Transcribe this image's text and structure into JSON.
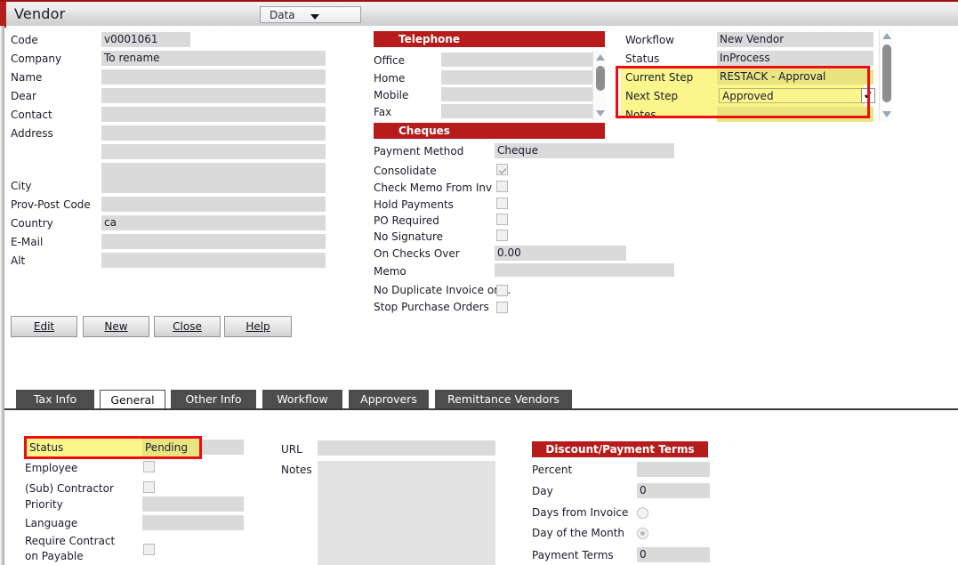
{
  "window": {
    "title": "Vendor",
    "data_menu": "Data"
  },
  "vendor_form": {
    "fields": [
      {
        "label": "Code",
        "value": "v0001061"
      },
      {
        "label": "Company",
        "value": "To rename"
      },
      {
        "label": "Name",
        "value": ""
      },
      {
        "label": "Dear",
        "value": ""
      },
      {
        "label": "Contact",
        "value": ""
      },
      {
        "label": "Address",
        "value": ""
      },
      {
        "label": "",
        "value": ""
      },
      {
        "label": "",
        "value": ""
      },
      {
        "label": "City",
        "value": ""
      },
      {
        "label": "Prov-Post Code",
        "value": ""
      },
      {
        "label": "Country",
        "value": "ca"
      },
      {
        "label": "E-Mail",
        "value": ""
      },
      {
        "label": "Alt",
        "value": ""
      }
    ]
  },
  "buttons": {
    "edit": "Edit",
    "new": "New",
    "close": "Close",
    "help": "Help"
  },
  "telephone": {
    "header": "Telephone",
    "rows": [
      {
        "label": "Office",
        "value": ""
      },
      {
        "label": "Home",
        "value": ""
      },
      {
        "label": "Mobile",
        "value": ""
      },
      {
        "label": "Fax",
        "value": ""
      }
    ]
  },
  "cheques": {
    "header": "Cheques",
    "payment_method_label": "Payment Method",
    "payment_method_value": "Cheque",
    "checkboxes": [
      {
        "label": "Consolidate",
        "checked": true
      },
      {
        "label": "Check Memo From Inv",
        "checked": false
      },
      {
        "label": "Hold Payments",
        "checked": false
      },
      {
        "label": "PO Required",
        "checked": false
      },
      {
        "label": "No Signature",
        "checked": false
      }
    ],
    "on_checks_over_label": "On Checks Over",
    "on_checks_over_value": "0.00",
    "memo_label": "Memo",
    "memo_value": "",
    "bottom_checkboxes": [
      {
        "label": "No Duplicate Invoice on...",
        "checked": false
      },
      {
        "label": "Stop Purchase Orders",
        "checked": false
      }
    ]
  },
  "workflow_panel": {
    "rows": [
      {
        "label": "Workflow",
        "value": "New Vendor"
      },
      {
        "label": "Status",
        "value": "InProcess"
      },
      {
        "label": "Current Step",
        "value": "RESTACK - Approval"
      },
      {
        "label": "Next Step",
        "value": "Approved"
      },
      {
        "label": "Notes",
        "value": ""
      }
    ],
    "confirm_icon": "✔"
  },
  "tabs": [
    {
      "label": "Tax Info",
      "active": false
    },
    {
      "label": "General",
      "active": true
    },
    {
      "label": "Other Info",
      "active": false
    },
    {
      "label": "Workflow",
      "active": false
    },
    {
      "label": "Approvers",
      "active": false
    },
    {
      "label": "Remittance Vendors",
      "active": false
    }
  ],
  "general_tab": {
    "status_label": "Status",
    "status_value": "Pending",
    "checkboxes": [
      {
        "label": "Employee",
        "checked": false
      },
      {
        "label": "(Sub) Contractor",
        "checked": false
      }
    ],
    "priority_label": "Priority",
    "priority_value": "",
    "language_label": "Language",
    "language_value": "",
    "require_contract_label_1": "Require Contract",
    "require_contract_label_2": "on Payable",
    "require_contract_checked": false,
    "url_label": "URL",
    "url_value": "",
    "notes_label": "Notes",
    "notes_value": ""
  },
  "discount_terms": {
    "header": "Discount/Payment Terms",
    "percent_label": "Percent",
    "percent_value": "",
    "day_label": "Day",
    "day_value": "0",
    "days_from_invoice_label": "Days from Invoice",
    "days_from_invoice_selected": false,
    "day_of_month_label": "Day of the Month",
    "day_of_month_selected": true,
    "payment_terms_label": "Payment Terms",
    "payment_terms_value": "0"
  },
  "colors": {
    "accent_red": "#b71c1c",
    "highlight_yellow": "#faf68c",
    "highlight_border": "#f20d0d",
    "tab_dark": "#4d4d4d"
  }
}
